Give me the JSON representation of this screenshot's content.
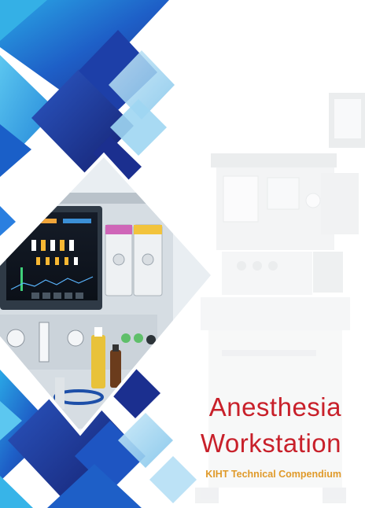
{
  "cover": {
    "title_line1": "Anesthesia",
    "title_line2": "Workstation",
    "subtitle": "KIHT Technical Compendium"
  },
  "colors": {
    "title": "#c8202a",
    "subtitle": "#e09a2a",
    "navy": "#1b2f8f",
    "blue": "#1e5fc7",
    "cyan": "#37b4e8",
    "light_blue": "#9fd6f2"
  }
}
